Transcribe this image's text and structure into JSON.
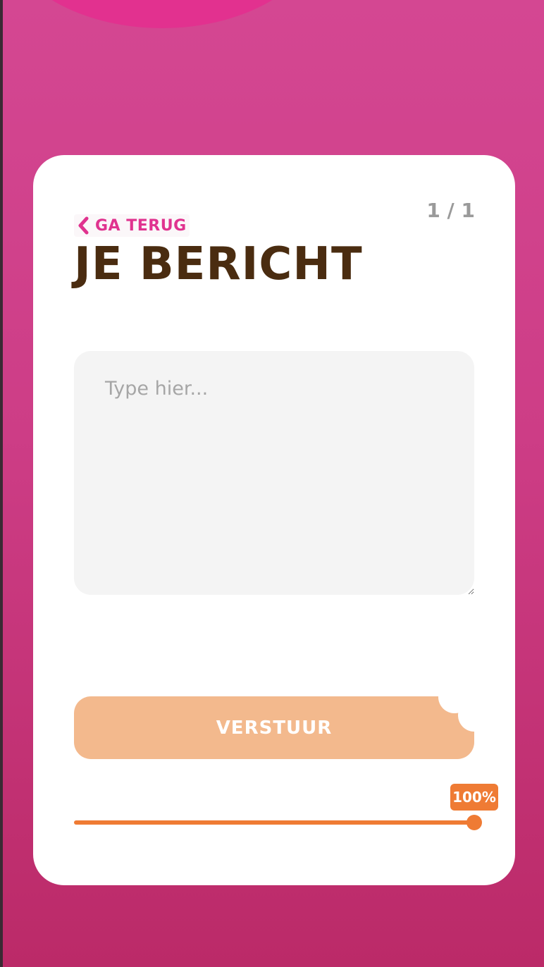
{
  "header": {
    "back_label": "GA TERUG",
    "page_counter": "1 / 1",
    "title": "JE BERICHT"
  },
  "message": {
    "placeholder": "Type hier...",
    "value": ""
  },
  "send": {
    "label": "VERSTUUR"
  },
  "progress": {
    "value": 1.0,
    "label": "100%"
  },
  "colors": {
    "background": "#cd3d86",
    "accent_pink": "#e0338f",
    "title_brown": "#4a2c10",
    "button_peach": "#f3b98d",
    "progress_orange": "#ef7b34",
    "card": "#ffffff",
    "input_bg": "#f4f4f4"
  },
  "icons": {
    "back": "chevron-left-icon"
  }
}
